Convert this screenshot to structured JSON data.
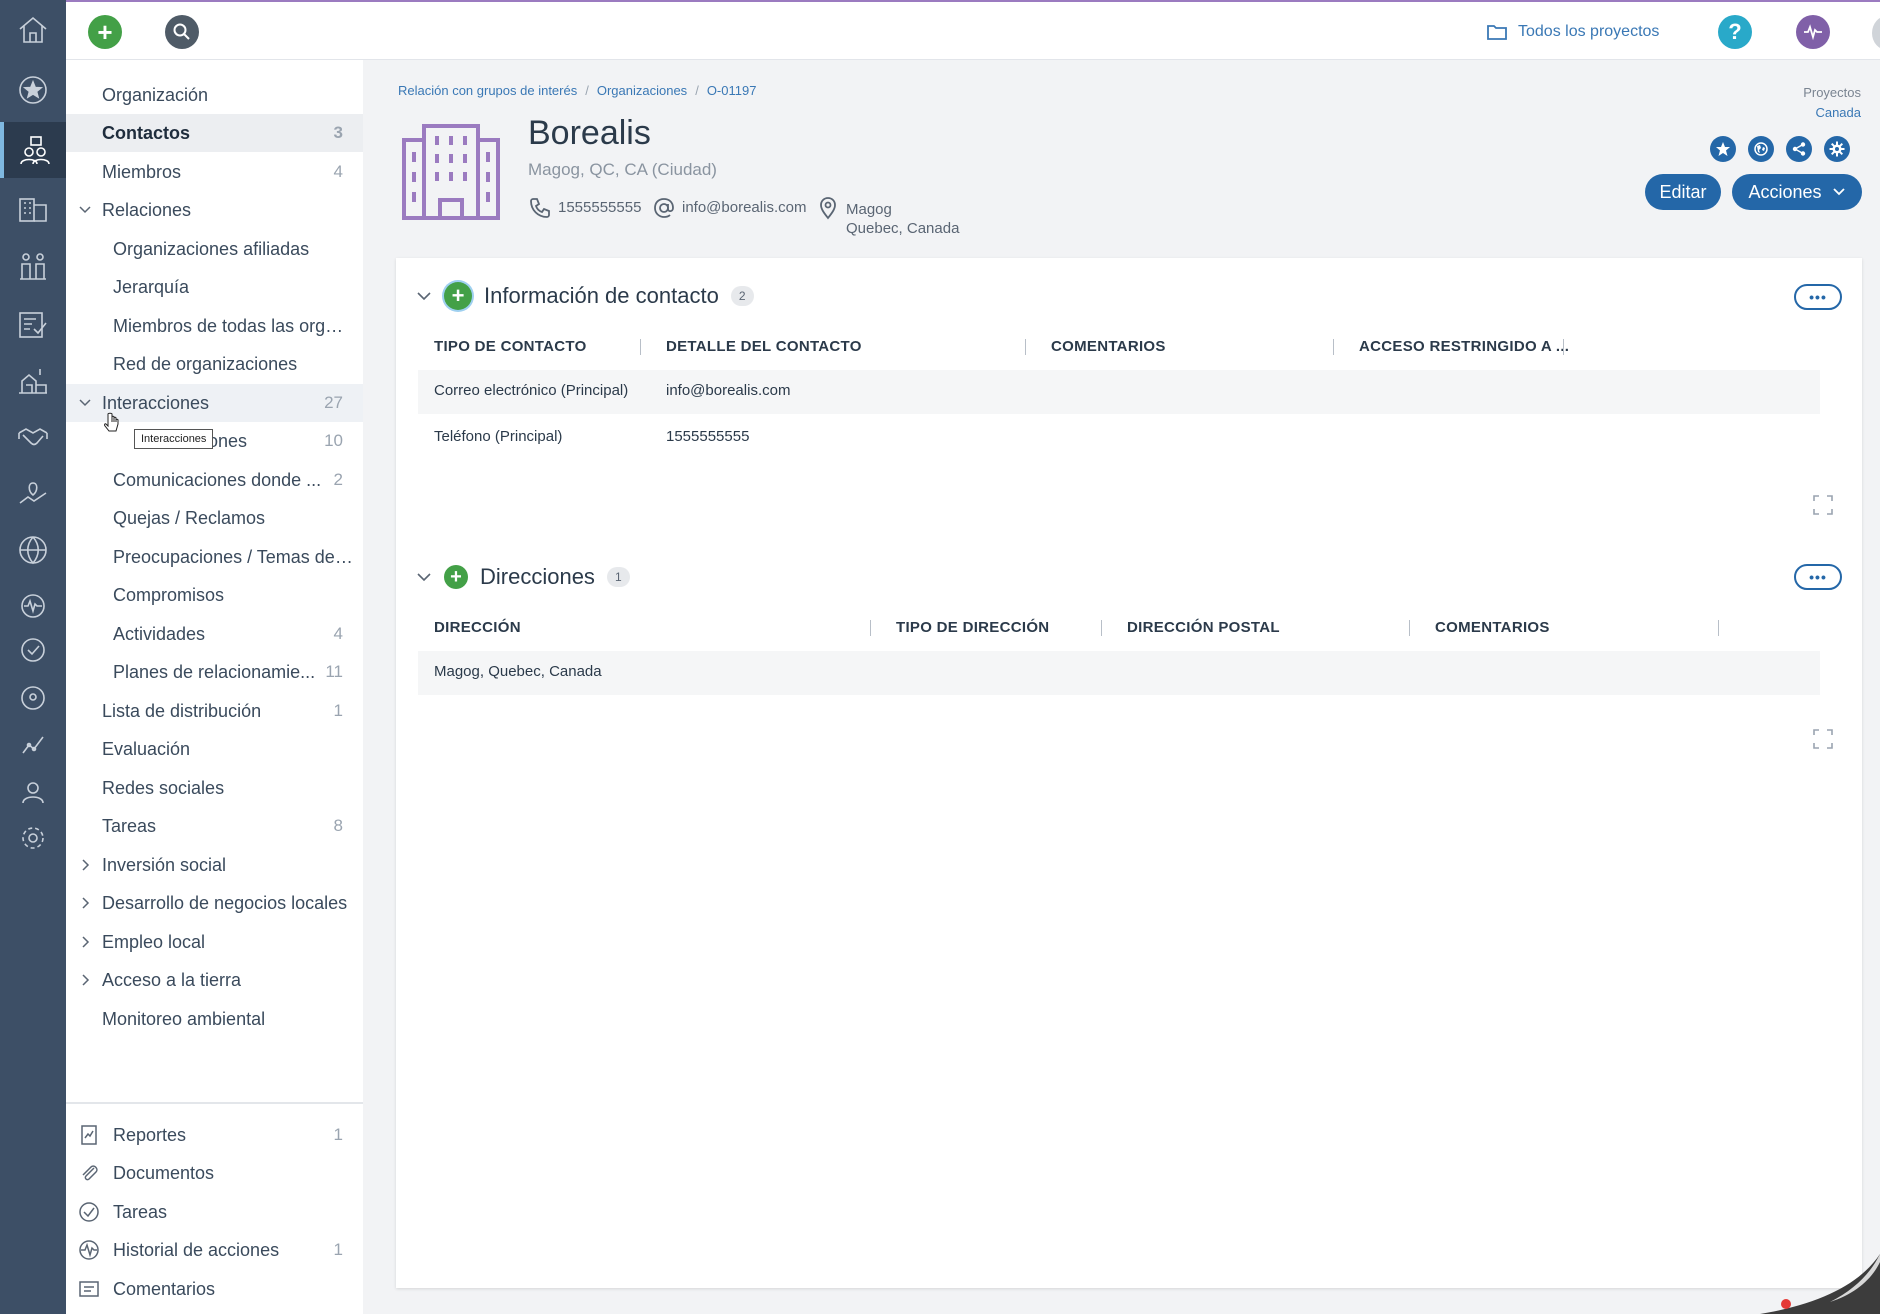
{
  "topbar": {
    "projects_label": "Todos los proyectos",
    "colors": {
      "add": "#43a047",
      "search": "#4f5b67",
      "help": "#29a9c9",
      "activity": "#8060a8"
    }
  },
  "rail": {
    "icons": [
      "home-icon",
      "star-icon",
      "stakeholders-icon",
      "buildings-icon",
      "community-icon",
      "survey-icon",
      "village-icon",
      "handshake-icon",
      "land-icon",
      "globe-icon",
      "pulse-icon",
      "check-icon",
      "location-icon",
      "chart-icon",
      "user-icon",
      "settings-icon"
    ]
  },
  "nav": {
    "items": [
      {
        "label": "Organización",
        "count": ""
      },
      {
        "label": "Contactos",
        "count": "3"
      },
      {
        "label": "Miembros",
        "count": "4"
      },
      {
        "label": "Relaciones",
        "count": ""
      },
      {
        "label": "Organizaciones afiliadas",
        "count": ""
      },
      {
        "label": "Jerarquía",
        "count": ""
      },
      {
        "label": "Miembros de todas las orga...",
        "count": ""
      },
      {
        "label": "Red de organizaciones",
        "count": ""
      },
      {
        "label": "Interacciones",
        "count": "27"
      },
      {
        "label": "ones",
        "count": "10"
      },
      {
        "label": "Comunicaciones donde ...",
        "count": "2"
      },
      {
        "label": "Quejas / Reclamos",
        "count": ""
      },
      {
        "label": "Preocupaciones / Temas de ...",
        "count": ""
      },
      {
        "label": "Compromisos",
        "count": ""
      },
      {
        "label": "Actividades",
        "count": "4"
      },
      {
        "label": "Planes de relacionamie...",
        "count": "11"
      },
      {
        "label": "Lista de distribución",
        "count": "1"
      },
      {
        "label": "Evaluación",
        "count": ""
      },
      {
        "label": "Redes sociales",
        "count": ""
      },
      {
        "label": "Tareas",
        "count": "8"
      },
      {
        "label": "Inversión social",
        "count": ""
      },
      {
        "label": "Desarrollo de negocios locales",
        "count": ""
      },
      {
        "label": "Empleo local",
        "count": ""
      },
      {
        "label": "Acceso a la tierra",
        "count": ""
      },
      {
        "label": "Monitoreo ambiental",
        "count": ""
      }
    ],
    "footer": [
      {
        "label": "Reportes",
        "count": "1"
      },
      {
        "label": "Documentos",
        "count": ""
      },
      {
        "label": "Tareas",
        "count": ""
      },
      {
        "label": "Historial de acciones",
        "count": "1"
      },
      {
        "label": "Comentarios",
        "count": ""
      }
    ],
    "tooltip": "Interacciones"
  },
  "breadcrumb": [
    "Relación con grupos de interés",
    "Organizaciones",
    "O-01197"
  ],
  "project": {
    "label": "Proyectos",
    "value": "Canada"
  },
  "org": {
    "name": "Borealis",
    "subtitle": "Magog, QC, CA (Ciudad)",
    "phone": "1555555555",
    "email": "info@borealis.com",
    "location_line1": "Magog",
    "location_line2": "Quebec, Canada",
    "icon_color": "#9b7bc0"
  },
  "buttons": {
    "edit": "Editar",
    "actions": "Acciones"
  },
  "contact_section": {
    "title": "Información de contacto",
    "count": "2",
    "more": "•••",
    "columns": [
      "TIPO DE CONTACTO",
      "DETALLE DEL CONTACTO",
      "COMENTARIOS",
      "ACCESO RESTRINGIDO A ..."
    ],
    "rows": [
      [
        "Correo electrónico (Principal)",
        "info@borealis.com",
        "",
        ""
      ],
      [
        "Teléfono (Principal)",
        "1555555555",
        "",
        ""
      ]
    ]
  },
  "address_section": {
    "title": "Direcciones",
    "count": "1",
    "more": "•••",
    "columns": [
      "DIRECCIÓN",
      "TIPO DE DIRECCIÓN",
      "DIRECCIÓN POSTAL",
      "COMENTARIOS"
    ],
    "rows": [
      [
        "Magog, Quebec, Canada",
        "",
        "",
        ""
      ]
    ]
  }
}
